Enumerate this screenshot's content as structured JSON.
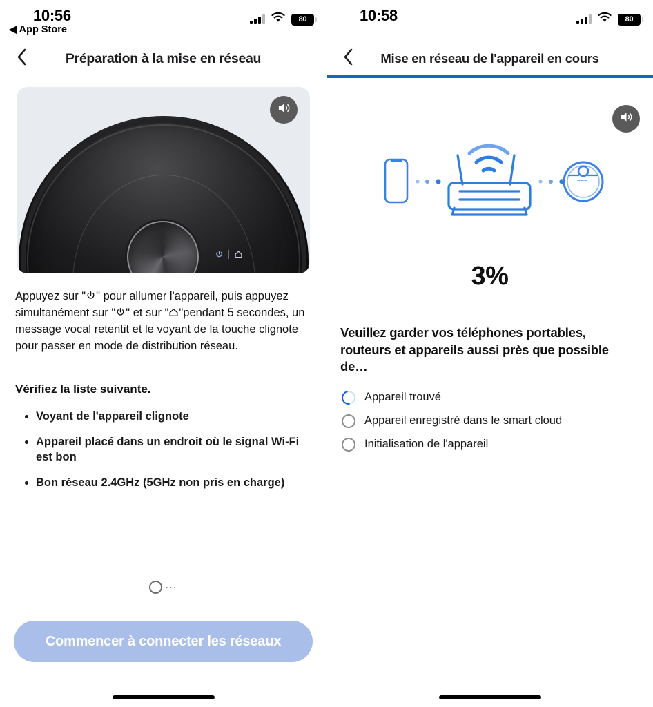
{
  "theme": {
    "accent_blue": "#1565C8",
    "button_disabled_blue": "#A9BFEA",
    "hero_background": "#E8EBF0",
    "speaker_button_background": "#5A5A5A",
    "text_primary": "#111111",
    "circle_gray": "#8E8E93"
  },
  "left_screen": {
    "status_bar": {
      "time": "10:56",
      "back_app_label": "◀ App Store",
      "battery_level": "80",
      "signal_icon": "cellular-signal-icon",
      "wifi_icon": "wifi-icon",
      "battery_icon": "battery-icon"
    },
    "nav": {
      "back_icon": "chevron-left-icon",
      "title": "Préparation à la mise en réseau"
    },
    "hero": {
      "image_alt": "robot-vacuum-photo",
      "speaker_icon": "speaker-icon",
      "device_power_icon": "power-icon",
      "device_home_icon": "home-icon"
    },
    "instructions": {
      "part1": "Appuyez sur \"",
      "icon1": "power-icon",
      "part2": "\" pour allumer l'appareil, puis appuyez simultanément sur \"",
      "icon2": "power-icon",
      "part3": "\" et sur \"",
      "icon3": "home-icon",
      "part4": "\"pendant 5 secondes, un message vocal retentit et le voyant de la touche clignote pour passer en mode de distribution réseau."
    },
    "checklist_heading": "Vérifiez la liste suivante.",
    "checklist": [
      "Voyant de l'appareil clignote",
      "Appareil placé dans un endroit où le signal Wi-Fi est bon",
      "Bon réseau 2.4GHz (5GHz non pris en charge)"
    ],
    "loading": {
      "spinner_icon": "loading-spinner-icon",
      "dots": "..."
    },
    "cta_label": "Commencer à connecter les réseaux",
    "home_indicator": "home-indicator"
  },
  "right_screen": {
    "status_bar": {
      "time": "10:58",
      "battery_level": "80",
      "signal_icon": "cellular-signal-icon",
      "wifi_icon": "wifi-icon",
      "battery_icon": "battery-icon"
    },
    "nav": {
      "back_icon": "chevron-left-icon",
      "title": "Mise en réseau de l'appareil en cours"
    },
    "progress": {
      "percent_value": 100,
      "percent_label": "3%"
    },
    "illustration": {
      "phone_icon": "smartphone-icon",
      "router_icon": "router-icon",
      "wifi_icon": "wifi-waves-icon",
      "robot_icon": "robot-vacuum-icon",
      "link_dots": "connection-dots"
    },
    "speaker_icon": "speaker-icon",
    "tip": "Veuillez garder vos téléphones portables, routeurs et appareils aussi près que possible de…",
    "steps": [
      {
        "label": "Appareil trouvé",
        "state": "active"
      },
      {
        "label": "Appareil enregistré dans le smart cloud",
        "state": "pending"
      },
      {
        "label": "Initialisation de l'appareil",
        "state": "pending"
      }
    ],
    "home_indicator": "home-indicator"
  }
}
